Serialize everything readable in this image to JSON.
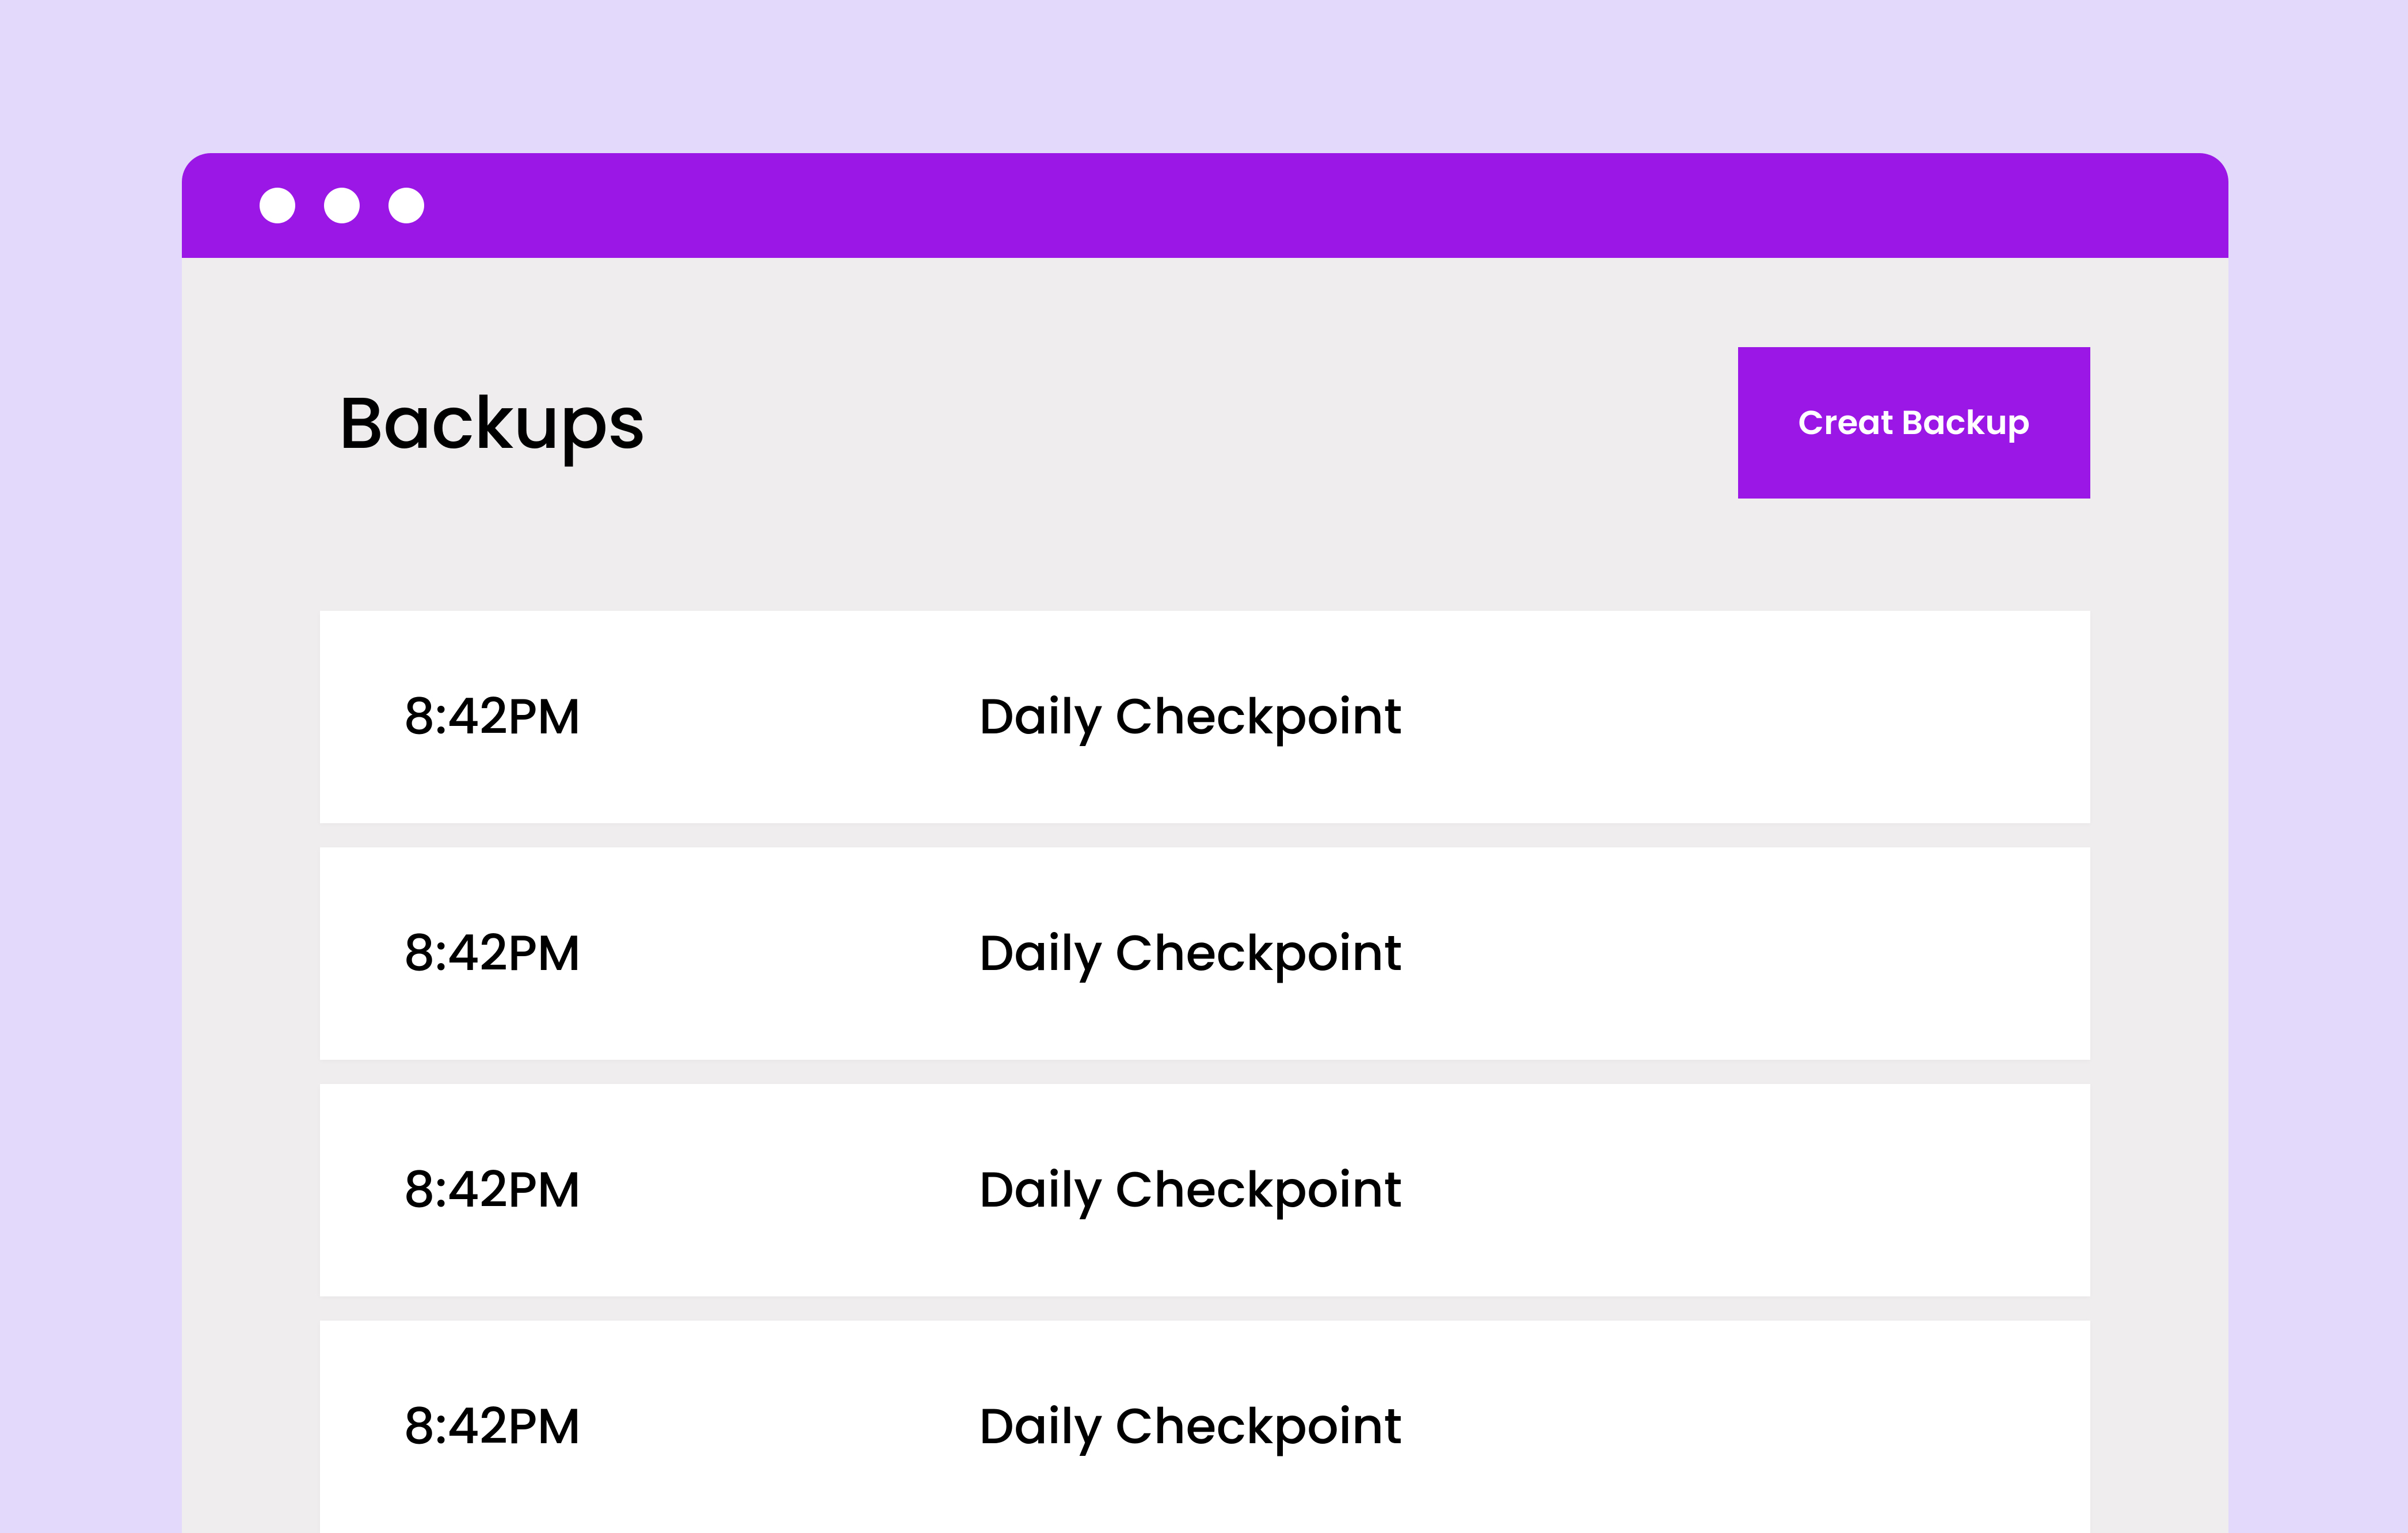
{
  "header": {
    "title": "Backups",
    "create_button_label": "Creat Backup"
  },
  "backups": [
    {
      "time": "8:42PM",
      "name": "Daily Checkpoint"
    },
    {
      "time": "8:42PM",
      "name": "Daily Checkpoint"
    },
    {
      "time": "8:42PM",
      "name": "Daily Checkpoint"
    },
    {
      "time": "8:42PM",
      "name": "Daily Checkpoint"
    }
  ],
  "colors": {
    "background": "#E3D9FA",
    "accent": "#9B17E6",
    "window_body": "#EFEDED",
    "card": "#FFFFFF"
  }
}
